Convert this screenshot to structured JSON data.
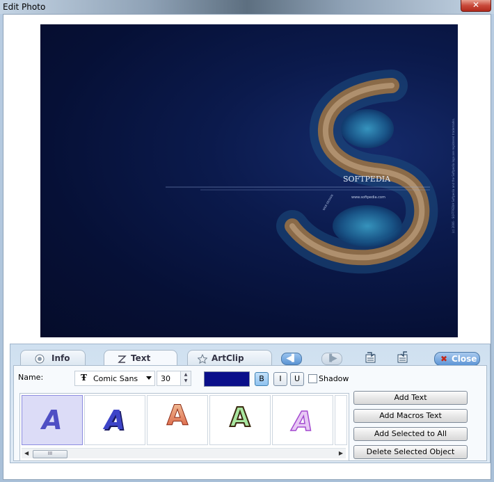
{
  "window": {
    "title": "Edit Photo",
    "close_glyph": "✕"
  },
  "photo": {
    "brand": "SOFTPEDIA",
    "url": "www.softpedia.com",
    "side_text": "(c) 2006 - SOFTPEDIA      Softpedia and the Softpedia logo are registered trademarks.",
    "curve_text": "WEB DESIGN"
  },
  "tabs": [
    {
      "label": "Info",
      "icon": "info-icon"
    },
    {
      "label": "Text",
      "icon": "text-tool-icon"
    },
    {
      "label": "ArtClip",
      "icon": "star-icon"
    }
  ],
  "toolbar": {
    "prev_glyph": "◀▌",
    "next_glyph": "▐▶",
    "close_label": "Close",
    "close_glyph": "✖"
  },
  "text_panel": {
    "name_label": "Name:",
    "font_name": "Comic Sans MS",
    "font_glyph": "Ŧ",
    "font_size": "30",
    "color": "#0a0f8a",
    "bold_label": "B",
    "italic_label": "I",
    "underline_label": "U",
    "bold_active": true,
    "shadow_label": "Shadow",
    "shadow_checked": false
  },
  "gallery": {
    "scroll_thumb": "III",
    "styles": [
      {
        "letter": "A",
        "style": "plain-blue",
        "selected": true
      },
      {
        "letter": "A",
        "style": "blue-bevel",
        "selected": false
      },
      {
        "letter": "A",
        "style": "orange-gradient",
        "selected": false
      },
      {
        "letter": "A",
        "style": "green-outline",
        "selected": false
      },
      {
        "letter": "A",
        "style": "purple-glow",
        "selected": false
      }
    ]
  },
  "actions": {
    "add_text": "Add Text",
    "add_macros_text": "Add Macros Text",
    "add_selected_to_all": "Add Selected to All",
    "delete_selected_object": "Delete Selected Object"
  },
  "colors": {
    "accent": "#5d95d6",
    "text_color": "#0a0f8a",
    "selection": "#dcdcf7"
  }
}
